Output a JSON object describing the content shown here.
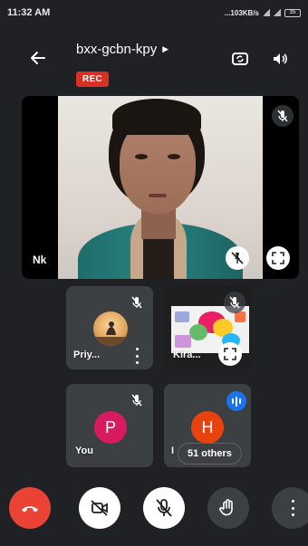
{
  "status_bar": {
    "time": "11:32 AM",
    "net_speed": "...103KB/s",
    "battery": "35"
  },
  "meeting": {
    "code": "bxx-gcbn-kpy",
    "rec_label": "REC"
  },
  "main_participant": {
    "name": "Nk"
  },
  "participants": [
    {
      "name": "Priy...",
      "type": "image-avatar"
    },
    {
      "name": "Kira...",
      "type": "screen-share"
    },
    {
      "name": "You",
      "initial": "P",
      "avatar_color": "#d81b60"
    },
    {
      "name": "I",
      "initial": "H",
      "avatar_color": "#e8430e"
    }
  ],
  "others": {
    "label": "51 others"
  },
  "controls": {
    "end_call": "end-call-icon",
    "camera": "camera-off-icon",
    "mic": "mic-off-icon",
    "hand": "raise-hand-icon",
    "more": "more-options-icon"
  },
  "colors": {
    "rec": "#d93025",
    "end_call": "#ea4335",
    "speaking": "#1a73e8"
  }
}
